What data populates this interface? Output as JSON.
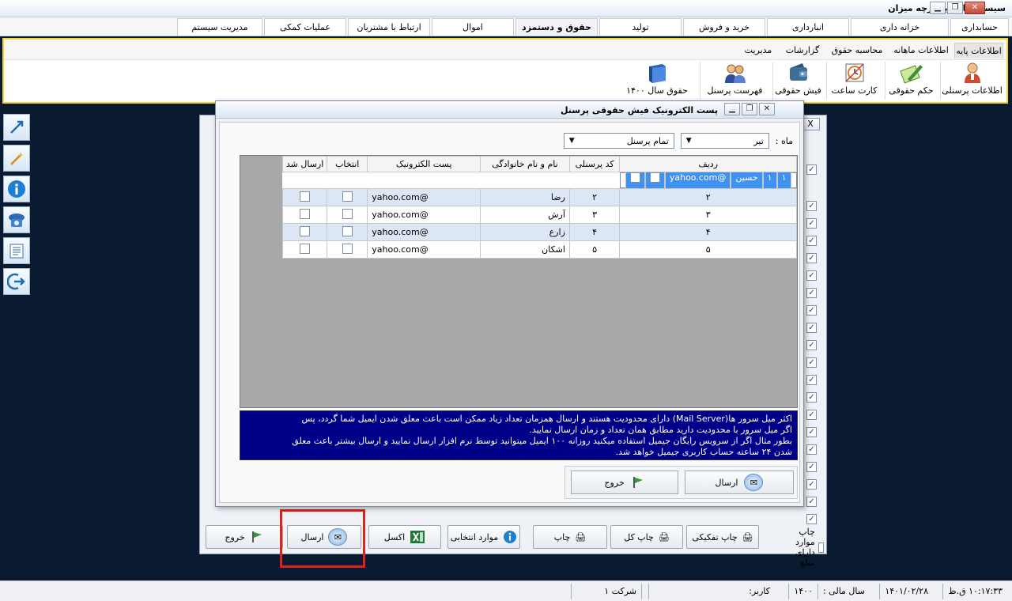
{
  "window": {
    "title": "سیستم مالی یکپارچه میزان"
  },
  "menu": {
    "tabs": [
      {
        "label": "حسابداری"
      },
      {
        "label": "خزانه داری"
      },
      {
        "label": "انبارداری"
      },
      {
        "label": "خرید و فروش"
      },
      {
        "label": "تولید"
      },
      {
        "label": "حقوق و دستمزد",
        "active": true
      },
      {
        "label": "اموال"
      },
      {
        "label": "ارتباط با مشتریان"
      },
      {
        "label": "عملیات کمکی"
      },
      {
        "label": "مدیریت سیستم"
      }
    ]
  },
  "ribbon": {
    "subtabs": [
      "اطلاعات پایه",
      "اطلاعات ماهانه",
      "محاسبه حقوق",
      "گزارشات",
      "مدیریت"
    ],
    "buttons": [
      {
        "label": "اطلاعات پرسنلی",
        "icon": "person-icon"
      },
      {
        "label": "حکم حقوقی",
        "icon": "decree-pen-icon"
      },
      {
        "label": "کارت ساعت",
        "icon": "clock-card-icon"
      },
      {
        "label": "فیش حقوقی",
        "icon": "wallet-icon"
      },
      {
        "label": "فهرست پرسنل",
        "icon": "people-icon"
      },
      {
        "label": "حقوق سال ۱۴۰۰",
        "icon": "book-icon"
      }
    ]
  },
  "sidebar": {
    "icons": [
      "resize-arrow-icon",
      "magic-wand-icon",
      "info-icon",
      "phone-icon",
      "notes-icon",
      "logout-icon"
    ]
  },
  "background_window": {
    "bottom_buttons": {
      "print_amount": "چاپ موارد دارای مبلغ",
      "print_separate": "چاپ تفکیکی",
      "print_all": "چاپ کل",
      "print": "چاپ",
      "selected_items": "موارد انتخابی",
      "excel": "اکسل",
      "send": "ارسال",
      "exit": "خروج"
    },
    "close": "X"
  },
  "dialog": {
    "title": "پست الکترونیک فیش حقوقی پرسنل",
    "month_label": "ماه :",
    "month_value": "تیر",
    "personnel_value": "تمام پرسنل",
    "columns": [
      "ردیف",
      "کد پرسنلی",
      "نام و نام خانوادگی",
      "پست الکترونیک",
      "انتخاب",
      "ارسال شد"
    ],
    "rows": [
      {
        "row": "۱",
        "code": "۱",
        "name": "حسین",
        "email": "@yahoo.com",
        "selected": false,
        "sent": false
      },
      {
        "row": "۲",
        "code": "۲",
        "name": "رضا",
        "email": "@yahoo.com",
        "selected": false,
        "sent": false
      },
      {
        "row": "۳",
        "code": "۳",
        "name": "آرش",
        "email": "@yahoo.com",
        "selected": false,
        "sent": false
      },
      {
        "row": "۴",
        "code": "۴",
        "name": "زارع",
        "email": "@yahoo.com",
        "selected": false,
        "sent": false
      },
      {
        "row": "۵",
        "code": "۵",
        "name": "اشکان",
        "email": "@yahoo.com",
        "selected": false,
        "sent": false
      }
    ],
    "notice_lines": [
      "اکثر میل سرور ها(Mail Server) دارای محدودیت هستند و ارسال همزمان تعداد زیاد ممکن است باعث معلق شدن  ایمیل شما گردد، پس",
      "اگر میل سرور با محدودیت دارید مطابق همان تعداد و زمان ارسال نمایید.",
      "بطور مثال اگر از سرویس رایگان جیمیل استفاده میکنید روزانه ۱۰۰ ایمیل میتوانید توسط نرم افزار ارسال نمایید و ارسال بیشتر باعث معلق",
      "شدن ۲۴ ساعته حساب کاربری جیمیل خواهد شد."
    ],
    "send_label": "ارسال",
    "exit_label": "خروج"
  },
  "statusbar": {
    "time": "۱۰:۱۷:۳۳ ق.ظ",
    "date": "۱۴۰۱/۰۲/۲۸",
    "fiscal_year_label": "سال مالی :",
    "fiscal_year": "۱۴۰۰",
    "user_label": "کاربر:",
    "company": "شرکت ۱"
  },
  "colors": {
    "accent_yellow": "#f3d534",
    "selected_row": "#3f92f0",
    "notice_bg": "#000088",
    "highlight_red": "#e2201d"
  }
}
